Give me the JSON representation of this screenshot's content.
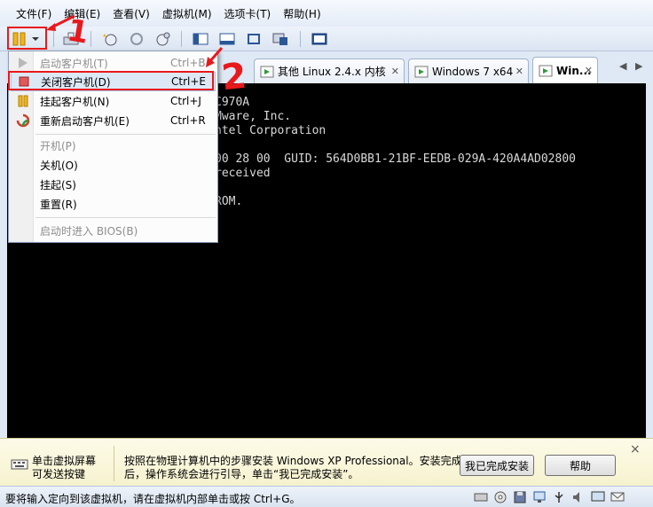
{
  "menubar": {
    "items": [
      "文件(F)",
      "编辑(E)",
      "查看(V)",
      "虚拟机(M)",
      "选项卡(T)",
      "帮助(H)"
    ]
  },
  "tabs": [
    {
      "label": "其他 Linux 2.4.x 内核"
    },
    {
      "label": "Windows 7 x64"
    },
    {
      "label": "Win..."
    }
  ],
  "power_menu": {
    "items": [
      {
        "label": "启动客户机(T)",
        "shortcut": "Ctrl+B"
      },
      {
        "label": "关闭客户机(D)",
        "shortcut": "Ctrl+E"
      },
      {
        "label": "挂起客户机(N)",
        "shortcut": "Ctrl+J"
      },
      {
        "label": "重新启动客户机(E)",
        "shortcut": "Ctrl+R"
      },
      {
        "label": "开机(P)"
      },
      {
        "label": "关机(O)"
      },
      {
        "label": "挂起(S)"
      },
      {
        "label": "重置(R)"
      },
      {
        "label": "启动时进入 BIOS(B)"
      }
    ]
  },
  "console": {
    "lines": [
      "C970A",
      "Mware, Inc.",
      "ntel Corporation",
      "",
      "00 28 00  GUID: 564D0BB1-21BF-EEDB-029A-420A4AD02800",
      "received",
      "",
      "ROM."
    ]
  },
  "annotations": {
    "step1": "1",
    "step2": "2"
  },
  "hintbar": {
    "left_text_line1": "单击虚拟屏幕",
    "left_text_line2": "可发送按键",
    "message_line1": "按照在物理计算机中的步骤安装 Windows XP Professional。安装完成",
    "message_line2": "后，操作系统会进行引导，单击“我已完成安装”。",
    "done_button": "我已完成安装",
    "help_button": "帮助",
    "close": "×"
  },
  "statusbar": {
    "text": "要将输入定向到该虚拟机，请在虚拟机内部单击或按 Ctrl+G。"
  },
  "colors": {
    "annotation_red": "#e8191c",
    "console_bg": "#000000"
  }
}
